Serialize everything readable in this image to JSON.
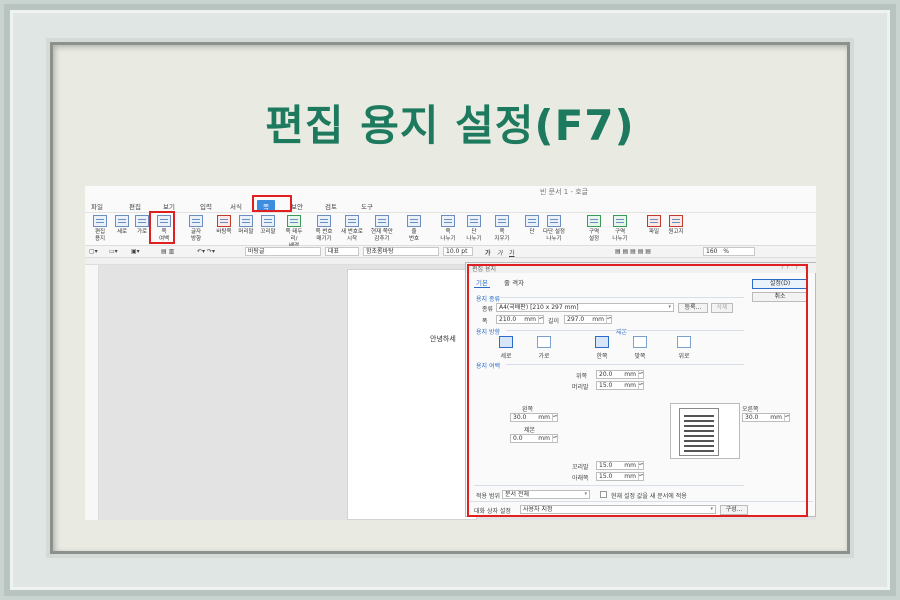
{
  "headline": "편집 용지 설정(F7)",
  "window_title": "빈 문서 1 - 호글",
  "menu": [
    "파일",
    "편집",
    "보기",
    "입력",
    "서식",
    "쪽",
    "보안",
    "검토",
    "도구"
  ],
  "menu_active": "쪽",
  "ribbon": [
    {
      "label": "편집\n용지",
      "color": "blue"
    },
    {
      "label": "세로",
      "color": "blue"
    },
    {
      "label": "가로",
      "color": "blue"
    },
    {
      "label": "쪽\n여백",
      "color": "blue"
    },
    {
      "label": "글자\n방향",
      "color": "blue"
    },
    {
      "label": "바탕쪽",
      "color": "red"
    },
    {
      "label": "머리말",
      "color": "blue"
    },
    {
      "label": "꼬리말",
      "color": "blue"
    },
    {
      "label": "쪽 테두리/\n배경",
      "color": "green"
    },
    {
      "label": "쪽 번호\n매기기",
      "color": "blue"
    },
    {
      "label": "새 번호로\n시작",
      "color": "blue"
    },
    {
      "label": "현재 쪽만\n감추기",
      "color": "blue"
    },
    {
      "label": "줄\n번호",
      "color": "blue"
    },
    {
      "label": "쪽\n나누기",
      "color": "blue"
    },
    {
      "label": "단\n나누기",
      "color": "blue"
    },
    {
      "label": "쪽\n지우기",
      "color": "blue"
    },
    {
      "label": "단",
      "color": "blue"
    },
    {
      "label": "다단 설정\n나누기",
      "color": "blue"
    },
    {
      "label": "구역\n설정",
      "color": "green"
    },
    {
      "label": "구역\n나누기",
      "color": "green"
    },
    {
      "label": "파일",
      "color": "red"
    },
    {
      "label": "원고지",
      "color": "red"
    }
  ],
  "format_bar": {
    "style": "바탕글",
    "lang": "대표",
    "font": "함초롬바탕",
    "size": "10.0",
    "size_unit": "pt",
    "bold": "가",
    "italic": "가",
    "underline": "가",
    "zoom": "160",
    "zoom_unit": "%"
  },
  "page_text": "안녕하세",
  "dialog": {
    "title": "편집 용지",
    "controls": "?? ? ×",
    "tabs": [
      "기본",
      "줄 격자"
    ],
    "paper_section": "용지 종류",
    "paper_kind_label": "종류",
    "paper_kind_value": "A4(국배판) [210 x 297 mm]",
    "register_button": "등록...",
    "delete_button": "삭제",
    "width_label": "폭",
    "width_value": "210.0",
    "height_label": "길이",
    "height_value": "297.0",
    "unit": "mm",
    "orientation_section": "용지 방향",
    "binding_section": "제본",
    "orient_portrait": "세로",
    "orient_landscape": "가로",
    "bind_single": "한쪽",
    "bind_facing": "맞쪽",
    "bind_top": "위로",
    "margin_section": "용지 여백",
    "top_label": "위쪽",
    "top_value": "20.0",
    "header_label": "머리말",
    "header_value": "15.0",
    "left_label": "왼쪽",
    "left_value": "30.0",
    "right_label": "오른쪽",
    "right_value": "30.0",
    "gutter_label": "제본",
    "gutter_value": "0.0",
    "footer_label": "꼬리말",
    "footer_value": "15.0",
    "bottom_label": "아래쪽",
    "bottom_value": "15.0",
    "apply_label": "적용 범위",
    "apply_value": "문서 전체",
    "apply_checkbox": "현재 설정 값을 새 문서에 적용",
    "dialog_setting_label": "대화 상자 설정",
    "dialog_setting_value": "사용자 지정",
    "compose_button": "구성...",
    "ok_button": "설정(D)",
    "cancel_button": "취소"
  }
}
